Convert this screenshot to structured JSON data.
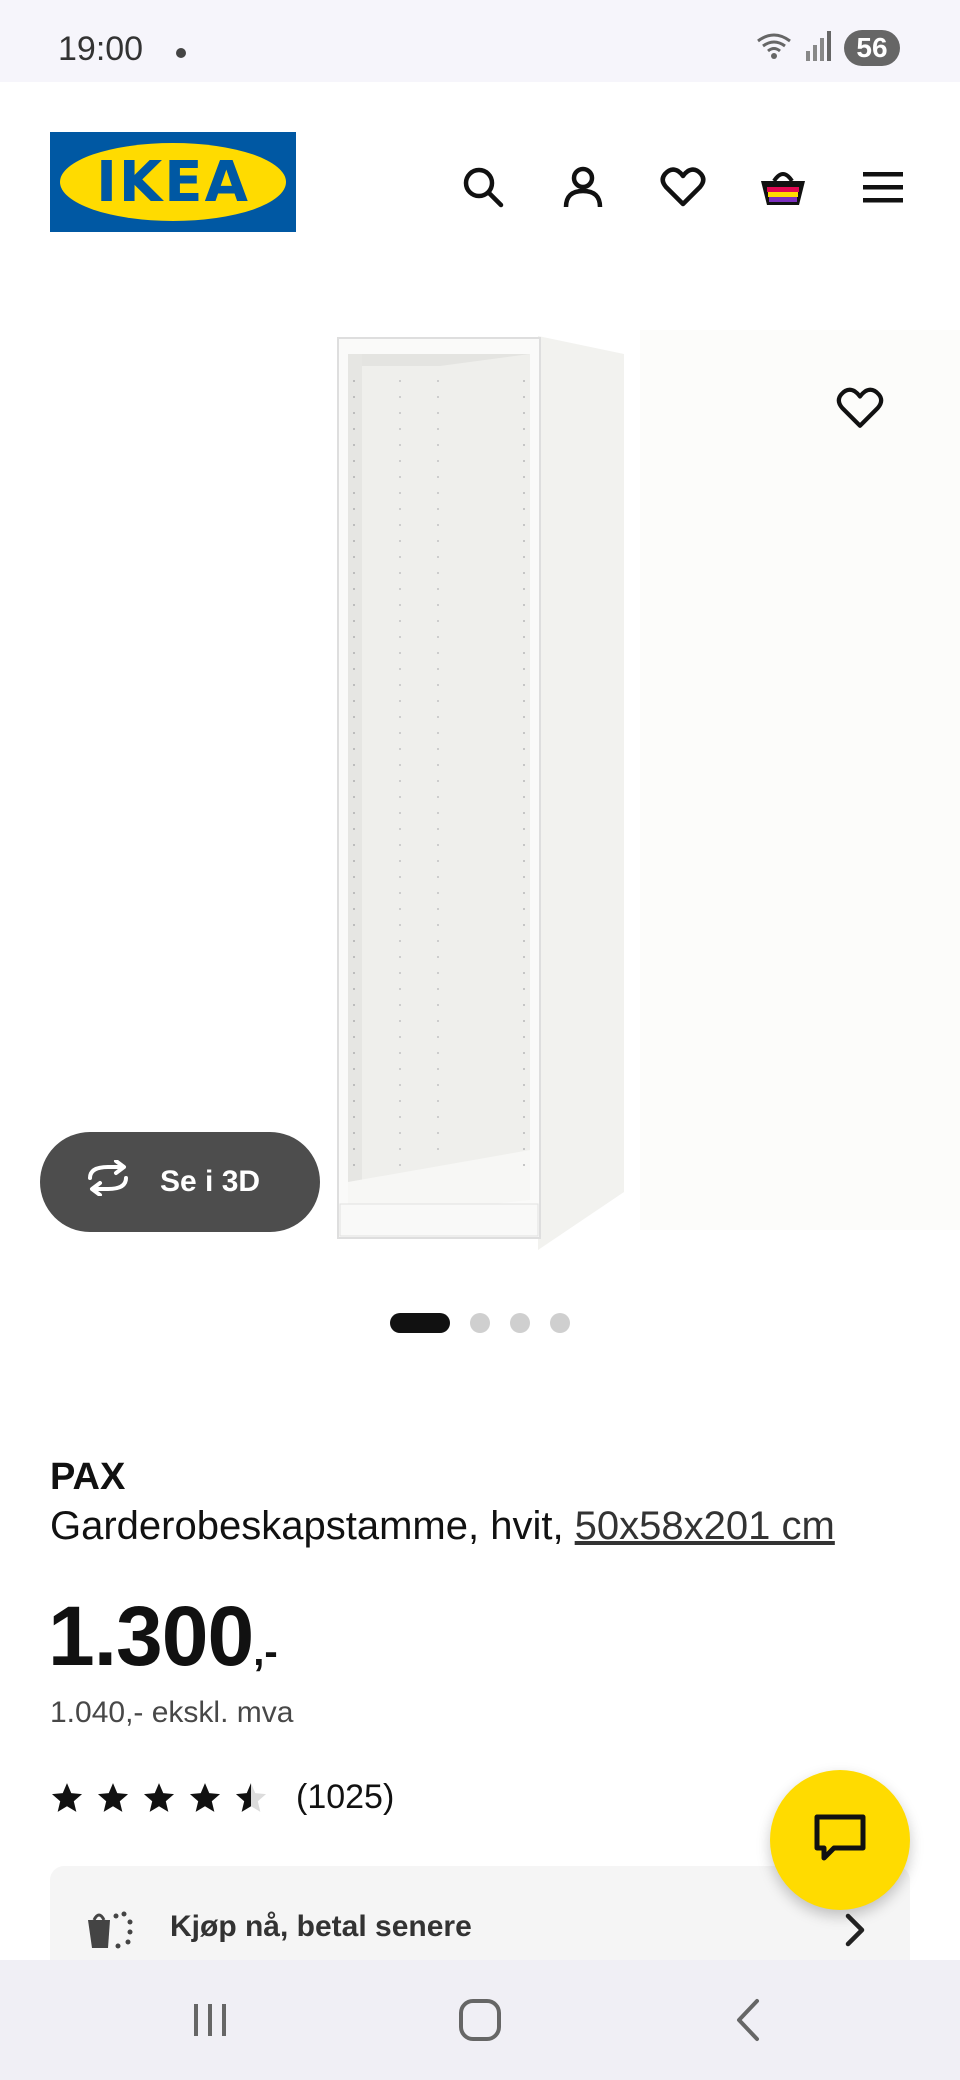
{
  "status_bar": {
    "time": "19:00",
    "battery_level": "56",
    "icons": [
      "wifi-icon",
      "signal-icon",
      "battery-icon"
    ]
  },
  "header": {
    "logo_text": "IKEA",
    "icons": [
      "search-icon",
      "account-icon",
      "wishlist-icon",
      "cart-icon",
      "menu-icon"
    ]
  },
  "gallery": {
    "view_3d_label": "Se i 3D",
    "slides_total": 4,
    "active_slide": 1
  },
  "product": {
    "name": "PAX",
    "description": "Garderobeskapstamme, hvit, ",
    "size": "50x58x201 cm",
    "price": "1.300",
    "price_suffix": ",-",
    "price_ex_vat": "1.040,- ekskl. mva",
    "rating_value": 4.5,
    "rating_max": 5,
    "review_count": "(1025)"
  },
  "payment": {
    "label": "Kjøp nå, betal senere"
  },
  "colors": {
    "brand_blue": "#0058a3",
    "brand_yellow": "#ffdb00",
    "text_primary": "#111111",
    "button_dark": "#4d4d4d"
  }
}
